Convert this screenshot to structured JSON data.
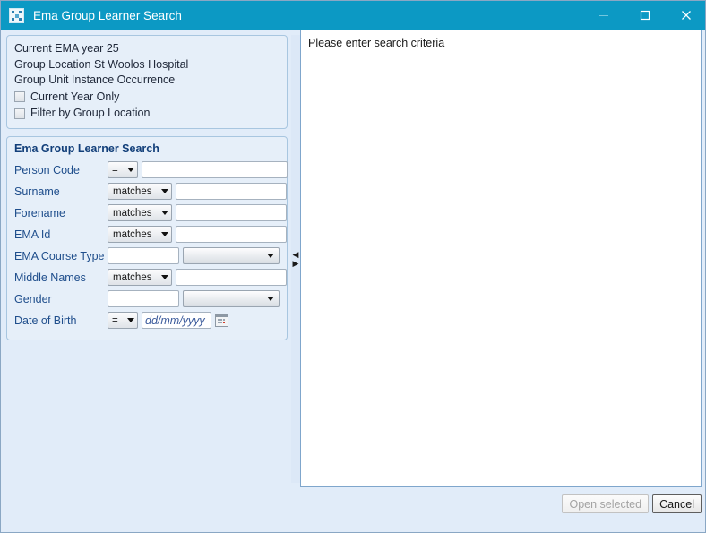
{
  "window": {
    "title": "Ema Group Learner Search",
    "icon": "app-grid-icon",
    "colors": {
      "titlebar": "#0c99c4",
      "body": "#e1ecf9",
      "label": "#1f4e8c",
      "heading": "#123f7a"
    },
    "controls": {
      "minimize": "─",
      "maximize": "□",
      "close": "✕"
    }
  },
  "info_panel": {
    "lines": [
      "Current EMA year  25",
      "Group Location  St Woolos Hospital",
      "Group Unit Instance Occurrence"
    ],
    "checkboxes": [
      {
        "label": "Current Year Only",
        "checked": false
      },
      {
        "label": "Filter by Group Location",
        "checked": false
      }
    ]
  },
  "search_panel": {
    "title": "Ema Group Learner Search",
    "rows": [
      {
        "label": "Person Code",
        "operator": "=",
        "value": "",
        "control": "op-text-narrow"
      },
      {
        "label": "Surname",
        "operator": "matches",
        "value": "",
        "control": "op-text-wide"
      },
      {
        "label": "Forename",
        "operator": "matches",
        "value": "",
        "control": "op-text-wide"
      },
      {
        "label": "EMA Id",
        "operator": "matches",
        "value": "",
        "control": "op-text-wide"
      },
      {
        "label": "EMA Course Type",
        "operator": "",
        "value": "",
        "control": "text-combo",
        "combo_value": ""
      },
      {
        "label": "Middle Names",
        "operator": "matches",
        "value": "",
        "control": "op-text-wide"
      },
      {
        "label": "Gender",
        "operator": "",
        "value": "",
        "control": "text-combo",
        "combo_value": ""
      },
      {
        "label": "Date of Birth",
        "operator": "=",
        "value": "",
        "control": "date",
        "placeholder": "dd/mm/yyyy"
      }
    ]
  },
  "splitter": {
    "collapse_left": "◀",
    "collapse_right": "▶"
  },
  "results": {
    "message": "Please enter search criteria"
  },
  "footer": {
    "open_selected_label": "Open selected",
    "open_selected_enabled": false,
    "cancel_label": "Cancel",
    "cancel_enabled": true
  }
}
